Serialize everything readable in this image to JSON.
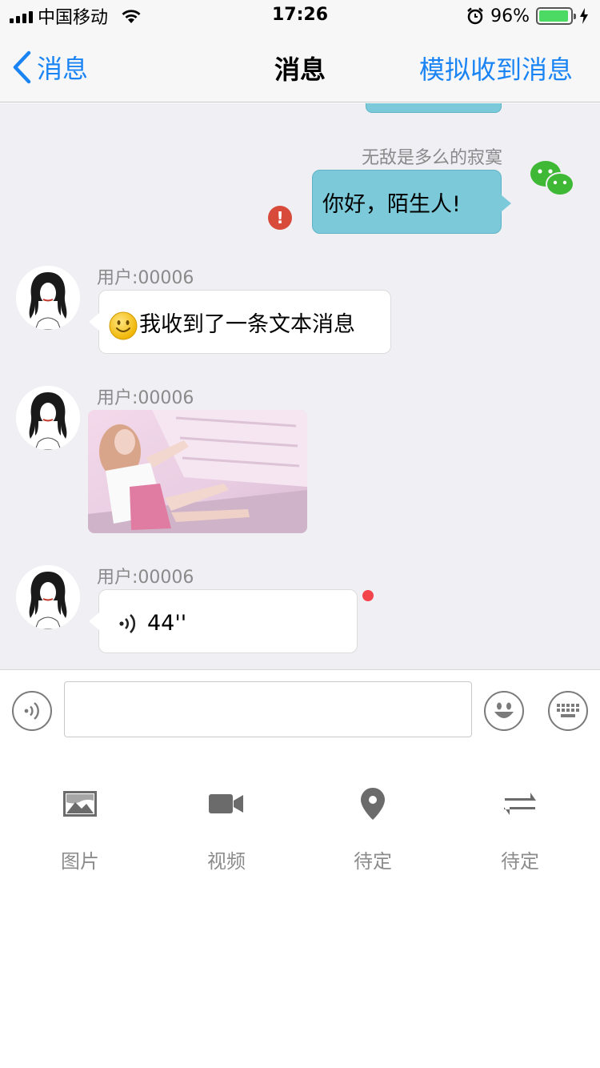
{
  "status_bar": {
    "carrier": "中国移动",
    "time": "17:26",
    "battery": "96%",
    "battery_level": 0.96
  },
  "nav": {
    "back_label": "消息",
    "title": "消息",
    "action_label": "模拟收到消息"
  },
  "messages": {
    "outgoing": {
      "sender": "无敌是多么的寂寞",
      "text": "你好，陌生人!",
      "error_mark": "!"
    },
    "incoming_text": {
      "sender": "用户:00006",
      "text": "我收到了一条文本消息"
    },
    "incoming_image": {
      "sender": "用户:00006"
    },
    "incoming_voice": {
      "sender": "用户:00006",
      "duration": "44''"
    }
  },
  "input": {
    "placeholder": ""
  },
  "panel": {
    "items": [
      {
        "label": "图片",
        "icon": "image-icon"
      },
      {
        "label": "视频",
        "icon": "video-icon"
      },
      {
        "label": "待定",
        "icon": "location-pin-icon"
      },
      {
        "label": "待定",
        "icon": "swap-icon"
      }
    ]
  },
  "colors": {
    "accent": "#1a84f4",
    "outgoing_bubble": "#7ccad9",
    "error": "#d84b3a",
    "unread_dot": "#f2464c",
    "chat_background": "#efeff4"
  }
}
